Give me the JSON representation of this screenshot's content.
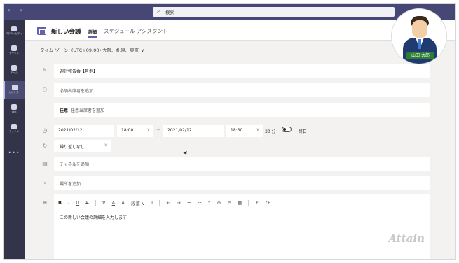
{
  "titlebar": {
    "nav_arrows": "‹ ›",
    "search_icon": "magnifier-icon",
    "search_placeholder": "検索"
  },
  "rail": {
    "items": [
      {
        "label": "アクティビティ",
        "icon": "bell-icon"
      },
      {
        "label": "チャット",
        "icon": "chat-icon"
      },
      {
        "label": "チーム",
        "icon": "teams-icon"
      },
      {
        "label": "カレンダー",
        "icon": "calendar-icon",
        "active": true
      },
      {
        "label": "通話",
        "icon": "phone-icon"
      },
      {
        "label": "ファイル",
        "icon": "file-icon"
      }
    ],
    "more": "•••"
  },
  "header": {
    "title": "新しい会議",
    "tab_detail": "詳細",
    "tab_assistant": "スケジュール アシスタント"
  },
  "timezone": {
    "label": "タイム ゾーン: (UTC+09:00) 大阪、札幌、東京",
    "chevron": "∨"
  },
  "form": {
    "title_value": "週評報告会【月例】",
    "required_placeholder": "必須出席者を追加",
    "optional_label": "任意",
    "optional_placeholder": "任意出席者を追加",
    "start_date": "2021/02/12",
    "start_time": "18:00",
    "end_date": "2021/02/12",
    "end_time": "18:30",
    "duration": "30 分",
    "all_day": "終日",
    "all_day_on": false,
    "repeat": "繰り返しなし",
    "channel_placeholder": "チャネルを追加",
    "location_placeholder": "場所を追加",
    "body_placeholder": "この新しい会議の詳細を入力します",
    "dropdown": "∨",
    "to_arrow": "→"
  },
  "toolbar": {
    "items": [
      "B",
      "I",
      "U",
      "S",
      "∀",
      "A",
      "A",
      "段落 ∨",
      "I",
      "⇤",
      "⇥",
      "☰",
      "☷",
      "❞",
      "⊖",
      "≡",
      "▦",
      "↶",
      "↷"
    ]
  },
  "watermark": "Attain",
  "avatar": {
    "name": "山田 太郎"
  }
}
